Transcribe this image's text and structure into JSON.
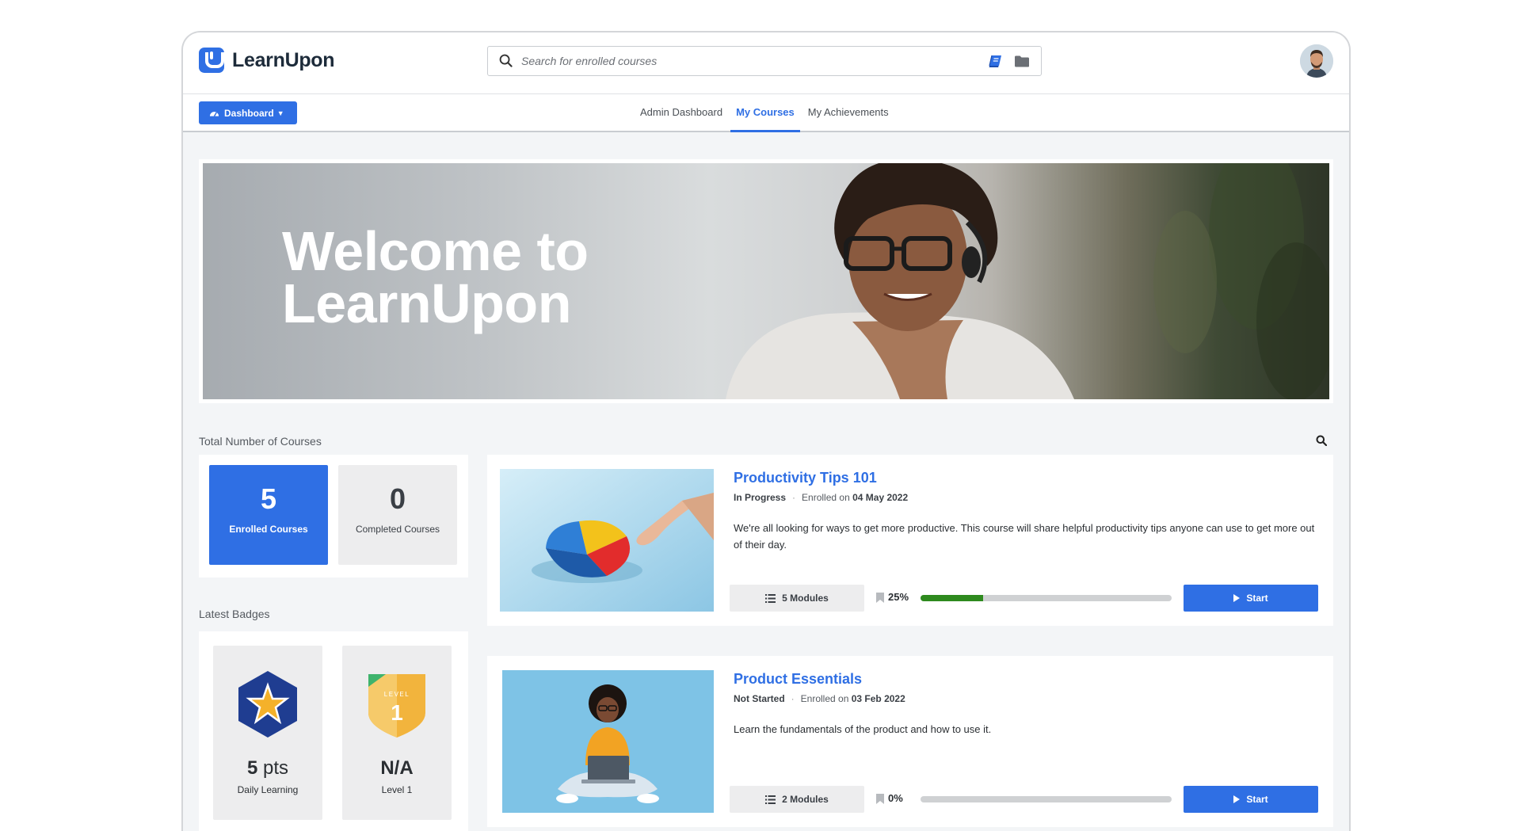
{
  "app": {
    "name": "LearnUpon"
  },
  "search": {
    "placeholder": "Search for enrolled courses"
  },
  "icons": {
    "search": "search-icon",
    "catalog": "book-icon",
    "library": "folder-icon",
    "avatar": "user-avatar"
  },
  "nav": {
    "dashboard_button": "Dashboard",
    "tabs": [
      {
        "label": "Admin Dashboard",
        "active": false
      },
      {
        "label": "My Courses",
        "active": true
      },
      {
        "label": "My Achievements",
        "active": false
      }
    ]
  },
  "hero": {
    "line1": "Welcome to",
    "line2": "LearnUpon"
  },
  "stats": {
    "section_label": "Total Number of Courses",
    "enrolled": {
      "value": "5",
      "label": "Enrolled Courses"
    },
    "completed": {
      "value": "0",
      "label": "Completed Courses"
    }
  },
  "badges": {
    "section_label": "Latest Badges",
    "items": [
      {
        "value": "5",
        "unit": "pts",
        "label": "Daily Learning",
        "icon": "star-hexagon-badge"
      },
      {
        "value": "N/A",
        "unit": "",
        "label": "Level 1",
        "icon": "level-shield-badge",
        "badge_text": "LEVEL",
        "badge_number": "1"
      }
    ]
  },
  "courses": [
    {
      "title": "Productivity Tips 101",
      "status": "In Progress",
      "enrolled_prefix": "Enrolled on",
      "enrolled_date": "04 May 2022",
      "description": "We're all looking for ways to get more productive. This course will share helpful productivity tips anyone can use to get more out of their day.",
      "modules": "5 Modules",
      "progress_label": "25%",
      "progress": 0.25,
      "action": "Start"
    },
    {
      "title": "Product Essentials",
      "status": "Not Started",
      "enrolled_prefix": "Enrolled on",
      "enrolled_date": "03 Feb 2022",
      "description": "Learn the fundamentals of the product and how to use it.",
      "modules": "2 Modules",
      "progress_label": "0%",
      "progress": 0,
      "action": "Start"
    }
  ],
  "colors": {
    "accent": "#2f6fe4",
    "progress": "#2e8a1e"
  }
}
